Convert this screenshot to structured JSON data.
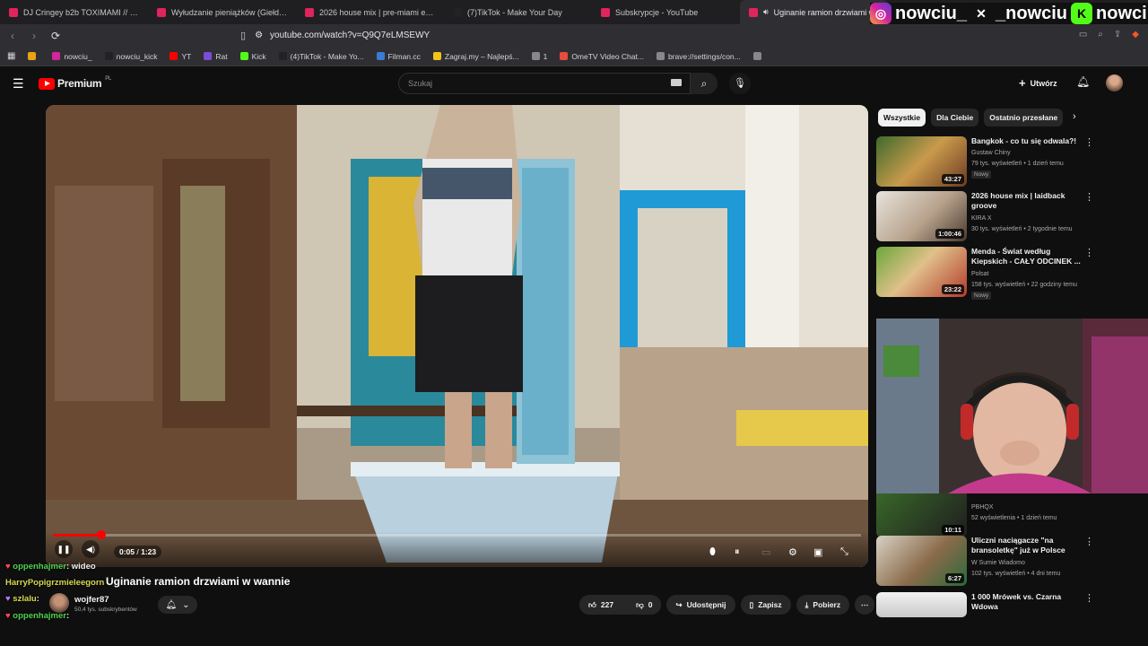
{
  "tabs": [
    {
      "label": "DJ Cringey b2b TOXIMAMI // Sexpre",
      "icon": "youtube-icon",
      "color": "#e0245e"
    },
    {
      "label": "Wyłudzanie pieniążków (Giełda - Od",
      "icon": "youtube-icon",
      "color": "#e0245e"
    },
    {
      "label": "2026 house mix | pre-miami energy",
      "icon": "youtube-icon",
      "color": "#e0245e"
    },
    {
      "label": "(7)TikTok - Make Your Day",
      "icon": "tiktok-icon",
      "color": "#222222"
    },
    {
      "label": "Subskrypcje - YouTube",
      "icon": "youtube-icon",
      "color": "#e0245e"
    },
    {
      "label": "Uginanie ramion drzwiami w",
      "icon": "youtube-icon",
      "color": "#e0245e",
      "active": true
    }
  ],
  "address": {
    "url": "youtube.com/watch?v=Q9Q7eLMSEWY"
  },
  "bookmarks": [
    {
      "label": "",
      "color": "#e8a317"
    },
    {
      "label": "nowciu_",
      "color": "#d6249f"
    },
    {
      "label": "nowciu_kick",
      "color": "#222222"
    },
    {
      "label": "YT",
      "color": "#ff0000"
    },
    {
      "label": "Rat",
      "color": "#7b4dd6"
    },
    {
      "label": "Kick",
      "color": "#53fc18"
    },
    {
      "label": "(4)TikTok - Make Yo...",
      "color": "#222222"
    },
    {
      "label": "Filman.cc",
      "color": "#3a7bd5"
    },
    {
      "label": "Zagraj.my – Najlepś...",
      "color": "#f0c419"
    },
    {
      "label": "1",
      "color": "#888888"
    },
    {
      "label": "OmeTV Video Chat...",
      "color": "#e74c3c"
    },
    {
      "label": "brave://settings/con...",
      "color": "#888888"
    },
    {
      "label": "",
      "color": "#888888"
    }
  ],
  "overlay_socials": [
    {
      "icon": "instagram-icon",
      "handle": "nowciu_"
    },
    {
      "icon": "x-icon",
      "handle": "_nowciu"
    },
    {
      "icon": "kick-icon",
      "handle": "nowciu"
    }
  ],
  "header": {
    "logo": "Premium",
    "logo_region": "PL",
    "search_placeholder": "Szukaj",
    "create_label": "Utwórz"
  },
  "player": {
    "time_current": "0:05",
    "time_total": "1:23",
    "progress": 0.06
  },
  "video": {
    "title": "Uginanie ramion drzwiami w wannie",
    "channel": "wojfer87",
    "subscribers": "50,4 tys. subskrybentów",
    "likes": "227",
    "dislikes": "0",
    "share_label": "Udostępnij",
    "save_label": "Zapisz",
    "download_label": "Pobierz"
  },
  "chat": [
    {
      "badge": "♥",
      "user": "oppenhajmer",
      "text": ": wideo"
    },
    {
      "badge": "",
      "user": "HarryPopigrzmieleegorn",
      "text": ""
    },
    {
      "badge": "♥",
      "user": "szlalu",
      "text": ":"
    },
    {
      "badge": "♥",
      "user": "oppenhajmer",
      "text": ":"
    }
  ],
  "chips": [
    "Wszystkie",
    "Dla Ciebie",
    "Ostatnio przesłane"
  ],
  "recommendations": [
    {
      "title": "Bangkok - co tu się odwala?!",
      "channel": "Gustaw Chiny",
      "meta": "79 tys. wyświetleń • 1 dzień temu",
      "badge": "Nowy",
      "duration": "43:27"
    },
    {
      "title": "2026 house mix | laidback groove",
      "channel": "KIRA X",
      "meta": "30 tys. wyświetleń • 2 tygodnie temu",
      "badge": "",
      "duration": "1:00:46"
    },
    {
      "title": "Menda - Świat według Kiepskich - CAŁY ODCINEK ...",
      "channel": "Polsat",
      "meta": "158 tys. wyświetleń • 22 godziny temu",
      "badge": "Nowy",
      "duration": "23:22"
    },
    {
      "title": "",
      "channel": "PBHQX",
      "meta": "52 wyświetlenia • 1 dzień temu",
      "badge": "",
      "duration": "10:11"
    },
    {
      "title": "Uliczni naciągacze \"na bransoletkę\" już w Polsce",
      "channel": "W Sumie Wiadomo",
      "meta": "102 tys. wyświetleń • 4 dni temu",
      "badge": "",
      "duration": "6:27"
    },
    {
      "title": "1 000 Mrówek vs. Czarna Wdowa",
      "channel": "",
      "meta": "",
      "badge": "",
      "duration": ""
    }
  ]
}
